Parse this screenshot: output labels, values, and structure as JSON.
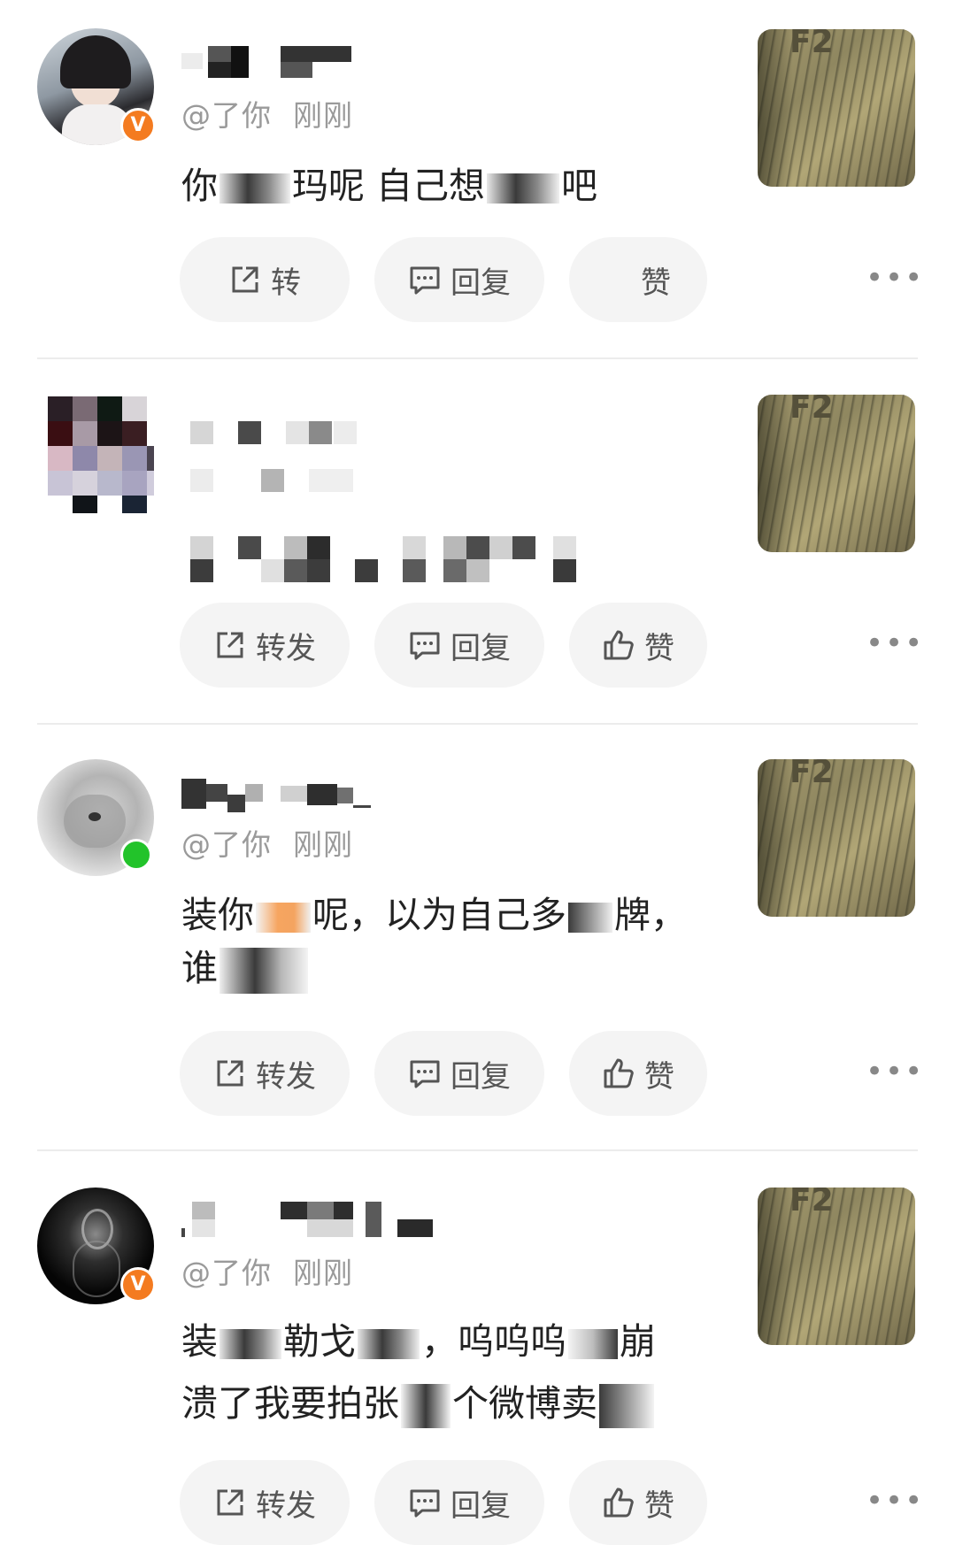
{
  "comments": [
    {
      "handle": "@了你",
      "time": "刚刚",
      "text_parts": [
        "你",
        "玛呢 自己想",
        "吧"
      ],
      "badge": "V",
      "badge_color": "#f47b20",
      "actions": {
        "share": "转",
        "reply": "回复",
        "like": "赞"
      }
    },
    {
      "handle": "",
      "time": "",
      "text_parts": [],
      "badge": "",
      "actions": {
        "share": "转发",
        "reply": "回复",
        "like": "赞"
      }
    },
    {
      "handle": "@了你",
      "time": "刚刚",
      "text_line1_parts": [
        "装你",
        "呢，以为自己多",
        "牌，"
      ],
      "text_line2_parts": [
        "谁",
        ""
      ],
      "badge_color": "#22c32a",
      "actions": {
        "share": "转发",
        "reply": "回复",
        "like": "赞"
      }
    },
    {
      "handle": "@了你",
      "time": "刚刚",
      "text_line1_parts": [
        "装",
        "勒戈",
        "，呜呜呜",
        "崩"
      ],
      "text_line2_parts": [
        "溃了我要拍张",
        "个微博卖"
      ],
      "badge": "V",
      "badge_color": "#f47b20",
      "actions": {
        "share": "转发",
        "reply": "回复",
        "like": "赞"
      }
    }
  ],
  "thumbnail_label": "F2",
  "more_label": "•••",
  "icons": {
    "share": "share-icon",
    "reply": "comment-icon",
    "like": "thumbs-up-icon",
    "more": "more-dots-icon"
  }
}
